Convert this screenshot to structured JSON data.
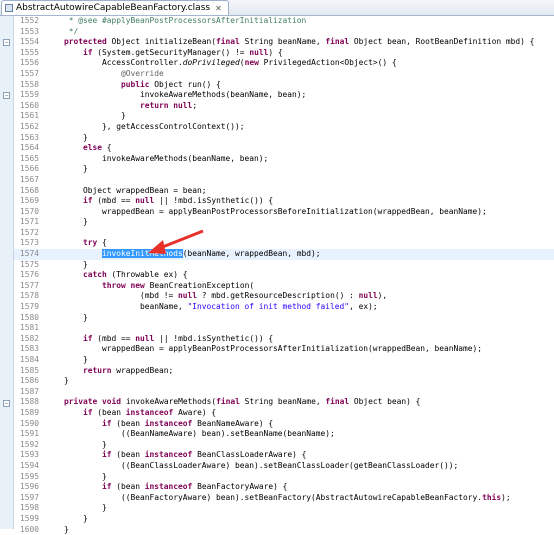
{
  "tab": {
    "title": "AbstractAutowireCapableBeanFactory.class",
    "close": "✕",
    "icon": "class-file-icon"
  },
  "colors": {
    "keyword": "#7f0055",
    "comment": "#3f7f5f",
    "string": "#2a00ff",
    "selection": "#3399ff",
    "current_line": "#e8f2fe",
    "arrow": "#e8302a"
  },
  "current_line": "1574",
  "lines": [
    {
      "n": "1552",
      "t": [
        [
          "cm",
          "\t * @see #applyBeanPostProcessorsAfterInitialization"
        ]
      ]
    },
    {
      "n": "1553",
      "t": [
        [
          "cm",
          "\t */"
        ]
      ]
    },
    {
      "n": "1554",
      "t": [
        [
          "",
          "\t"
        ],
        [
          "kw",
          "protected"
        ],
        [
          "",
          " Object initializeBean("
        ],
        [
          "kw",
          "final"
        ],
        [
          "",
          " String beanName, "
        ],
        [
          "kw",
          "final"
        ],
        [
          "",
          " Object bean, RootBeanDefinition mbd) {"
        ]
      ]
    },
    {
      "n": "1555",
      "t": [
        [
          "",
          "\t\t"
        ],
        [
          "kw",
          "if"
        ],
        [
          "",
          " (System.getSecurityManager() != "
        ],
        [
          "kw",
          "null"
        ],
        [
          "",
          ") {"
        ]
      ]
    },
    {
      "n": "1556",
      "t": [
        [
          "",
          "\t\t\tAccessController."
        ],
        [
          "i",
          "doPrivileged"
        ],
        [
          "",
          "("
        ],
        [
          "kw",
          "new"
        ],
        [
          "",
          " PrivilegedAction<Object>() {"
        ]
      ]
    },
    {
      "n": "1557",
      "t": [
        [
          "",
          "\t\t\t\t"
        ],
        [
          "ann",
          "@Override"
        ]
      ]
    },
    {
      "n": "1558",
      "t": [
        [
          "",
          "\t\t\t\t"
        ],
        [
          "kw",
          "public"
        ],
        [
          "",
          " Object run() {"
        ]
      ]
    },
    {
      "n": "1559",
      "t": [
        [
          "",
          "\t\t\t\t\tinvokeAwareMethods(beanName, bean);"
        ]
      ]
    },
    {
      "n": "1560",
      "t": [
        [
          "",
          "\t\t\t\t\t"
        ],
        [
          "kw",
          "return"
        ],
        [
          "",
          " "
        ],
        [
          "kw",
          "null"
        ],
        [
          "",
          ";"
        ]
      ]
    },
    {
      "n": "1561",
      "t": [
        [
          "",
          "\t\t\t\t}"
        ]
      ]
    },
    {
      "n": "1562",
      "t": [
        [
          "",
          "\t\t\t}, getAccessControlContext());"
        ]
      ]
    },
    {
      "n": "1563",
      "t": [
        [
          "",
          "\t\t}"
        ]
      ]
    },
    {
      "n": "1564",
      "t": [
        [
          "",
          "\t\t"
        ],
        [
          "kw",
          "else"
        ],
        [
          "",
          " {"
        ]
      ]
    },
    {
      "n": "1565",
      "t": [
        [
          "",
          "\t\t\tinvokeAwareMethods(beanName, bean);"
        ]
      ]
    },
    {
      "n": "1566",
      "t": [
        [
          "",
          "\t\t}"
        ]
      ]
    },
    {
      "n": "1567",
      "t": [
        [
          "",
          ""
        ]
      ]
    },
    {
      "n": "1568",
      "t": [
        [
          "",
          "\t\tObject wrappedBean = bean;"
        ]
      ]
    },
    {
      "n": "1569",
      "t": [
        [
          "",
          "\t\t"
        ],
        [
          "kw",
          "if"
        ],
        [
          "",
          " (mbd == "
        ],
        [
          "kw",
          "null"
        ],
        [
          "",
          " || !mbd.isSynthetic()) {"
        ]
      ]
    },
    {
      "n": "1570",
      "t": [
        [
          "",
          "\t\t\twrappedBean = applyBeanPostProcessorsBeforeInitialization(wrappedBean, beanName);"
        ]
      ]
    },
    {
      "n": "1571",
      "t": [
        [
          "",
          "\t\t}"
        ]
      ]
    },
    {
      "n": "1572",
      "t": [
        [
          "",
          ""
        ]
      ]
    },
    {
      "n": "1573",
      "t": [
        [
          "",
          "\t\t"
        ],
        [
          "kw",
          "try"
        ],
        [
          "",
          " {"
        ]
      ]
    },
    {
      "n": "1574",
      "t": [
        [
          "",
          "\t\t\t"
        ],
        [
          "sel",
          "invokeInitMethods"
        ],
        [
          "",
          "(beanName, wrappedBean, mbd);"
        ]
      ]
    },
    {
      "n": "1575",
      "t": [
        [
          "",
          "\t\t}"
        ]
      ]
    },
    {
      "n": "1576",
      "t": [
        [
          "",
          "\t\t"
        ],
        [
          "kw",
          "catch"
        ],
        [
          "",
          " (Throwable ex) {"
        ]
      ]
    },
    {
      "n": "1577",
      "t": [
        [
          "",
          "\t\t\t"
        ],
        [
          "kw",
          "throw"
        ],
        [
          "",
          " "
        ],
        [
          "kw",
          "new"
        ],
        [
          "",
          " BeanCreationException("
        ]
      ]
    },
    {
      "n": "1578",
      "t": [
        [
          "",
          "\t\t\t\t\t(mbd != "
        ],
        [
          "kw",
          "null"
        ],
        [
          "",
          " ? mbd.getResourceDescription() : "
        ],
        [
          "kw",
          "null"
        ],
        [
          "",
          "),"
        ]
      ]
    },
    {
      "n": "1579",
      "t": [
        [
          "",
          "\t\t\t\t\tbeanName, "
        ],
        [
          "str",
          "\"Invocation of init method failed\""
        ],
        [
          "",
          ", ex);"
        ]
      ]
    },
    {
      "n": "1580",
      "t": [
        [
          "",
          "\t\t}"
        ]
      ]
    },
    {
      "n": "1581",
      "t": [
        [
          "",
          ""
        ]
      ]
    },
    {
      "n": "1582",
      "t": [
        [
          "",
          "\t\t"
        ],
        [
          "kw",
          "if"
        ],
        [
          "",
          " (mbd == "
        ],
        [
          "kw",
          "null"
        ],
        [
          "",
          " || !mbd.isSynthetic()) {"
        ]
      ]
    },
    {
      "n": "1583",
      "t": [
        [
          "",
          "\t\t\twrappedBean = applyBeanPostProcessorsAfterInitialization(wrappedBean, beanName);"
        ]
      ]
    },
    {
      "n": "1584",
      "t": [
        [
          "",
          "\t\t}"
        ]
      ]
    },
    {
      "n": "1585",
      "t": [
        [
          "",
          "\t\t"
        ],
        [
          "kw",
          "return"
        ],
        [
          "",
          " wrappedBean;"
        ]
      ]
    },
    {
      "n": "1586",
      "t": [
        [
          "",
          "\t}"
        ]
      ]
    },
    {
      "n": "1587",
      "t": [
        [
          "",
          ""
        ]
      ]
    },
    {
      "n": "1588",
      "t": [
        [
          "",
          "\t"
        ],
        [
          "kw",
          "private"
        ],
        [
          "",
          " "
        ],
        [
          "kw",
          "void"
        ],
        [
          "",
          " invokeAwareMethods("
        ],
        [
          "kw",
          "final"
        ],
        [
          "",
          " String beanName, "
        ],
        [
          "kw",
          "final"
        ],
        [
          "",
          " Object bean) {"
        ]
      ]
    },
    {
      "n": "1589",
      "t": [
        [
          "",
          "\t\t"
        ],
        [
          "kw",
          "if"
        ],
        [
          "",
          " (bean "
        ],
        [
          "kw",
          "instanceof"
        ],
        [
          "",
          " Aware) {"
        ]
      ]
    },
    {
      "n": "1590",
      "t": [
        [
          "",
          "\t\t\t"
        ],
        [
          "kw",
          "if"
        ],
        [
          "",
          " (bean "
        ],
        [
          "kw",
          "instanceof"
        ],
        [
          "",
          " BeanNameAware) {"
        ]
      ]
    },
    {
      "n": "1591",
      "t": [
        [
          "",
          "\t\t\t\t((BeanNameAware) bean).setBeanName(beanName);"
        ]
      ]
    },
    {
      "n": "1592",
      "t": [
        [
          "",
          "\t\t\t}"
        ]
      ]
    },
    {
      "n": "1593",
      "t": [
        [
          "",
          "\t\t\t"
        ],
        [
          "kw",
          "if"
        ],
        [
          "",
          " (bean "
        ],
        [
          "kw",
          "instanceof"
        ],
        [
          "",
          " BeanClassLoaderAware) {"
        ]
      ]
    },
    {
      "n": "1594",
      "t": [
        [
          "",
          "\t\t\t\t((BeanClassLoaderAware) bean).setBeanClassLoader(getBeanClassLoader());"
        ]
      ]
    },
    {
      "n": "1595",
      "t": [
        [
          "",
          "\t\t\t}"
        ]
      ]
    },
    {
      "n": "1596",
      "t": [
        [
          "",
          "\t\t\t"
        ],
        [
          "kw",
          "if"
        ],
        [
          "",
          " (bean "
        ],
        [
          "kw",
          "instanceof"
        ],
        [
          "",
          " BeanFactoryAware) {"
        ]
      ]
    },
    {
      "n": "1597",
      "t": [
        [
          "",
          "\t\t\t\t((BeanFactoryAware) bean).setBeanFactory(AbstractAutowireCapableBeanFactory."
        ],
        [
          "kw",
          "this"
        ],
        [
          "",
          ");"
        ]
      ]
    },
    {
      "n": "1598",
      "t": [
        [
          "",
          "\t\t\t}"
        ]
      ]
    },
    {
      "n": "1599",
      "t": [
        [
          "",
          "\t\t}"
        ]
      ]
    },
    {
      "n": "1600",
      "t": [
        [
          "",
          "\t}"
        ]
      ]
    }
  ]
}
